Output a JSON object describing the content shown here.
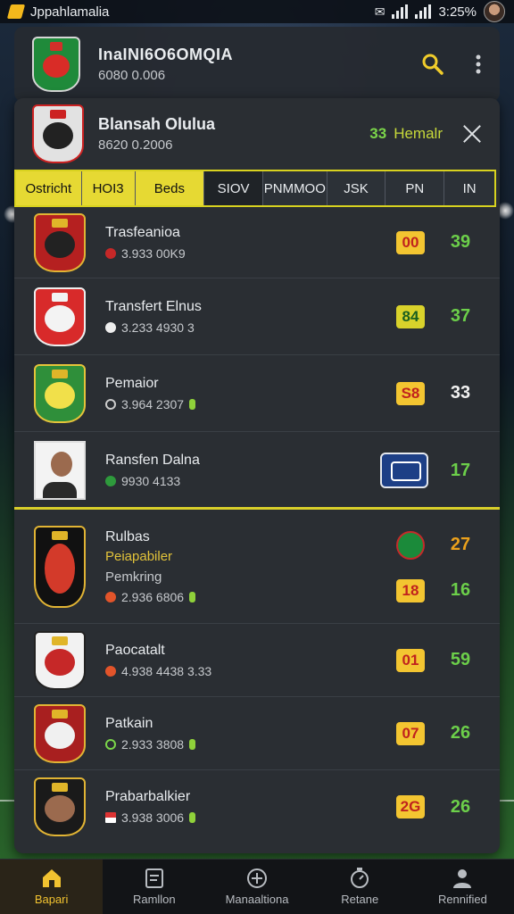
{
  "status_bar": {
    "app_name": "Jppahlamalia",
    "time": "3:25%"
  },
  "header": {
    "title": "InaINI6O6OMQIA",
    "subtitle": "6080 0.006"
  },
  "panel": {
    "title": "Blansah Olulua",
    "subtitle": "8620 0.2006",
    "status_num": "33",
    "status_label": "Hemalr"
  },
  "tabs": [
    {
      "label": "Ostricht",
      "style": "yellow"
    },
    {
      "label": "HOI3",
      "style": "yellow"
    },
    {
      "label": "Beds",
      "style": "yellow"
    },
    {
      "label": "SIOV",
      "style": "active"
    },
    {
      "label": "PNMMOO",
      "style": "dark"
    },
    {
      "label": "JSK",
      "style": "dark"
    },
    {
      "label": "PN",
      "style": "dark"
    },
    {
      "label": "IN",
      "style": "dark"
    }
  ],
  "rows": [
    {
      "name": "Trasfeanioa",
      "meta": "3.933 00K9",
      "pill": "00",
      "score": "39"
    },
    {
      "name": "Transfert Elnus",
      "meta": "3.233 4930 3",
      "pill": "84",
      "score": "37"
    },
    {
      "name": "Pemaior",
      "meta": "3.964 2307",
      "pill": "S8",
      "score": "33"
    },
    {
      "name": "Ransfen Dalna",
      "meta": "9930 4133",
      "score": "17"
    },
    {
      "name": "Rulbas",
      "sub": "Peiapabiler",
      "sub2": "Pemkring",
      "meta": "2.936 6806",
      "pill": "18",
      "score": "16",
      "side_score": "27"
    },
    {
      "name": "Paocatalt",
      "meta": "4.938 4438 3.33",
      "pill": "01",
      "score": "59"
    },
    {
      "name": "Patkain",
      "meta": "2.933 3808",
      "pill": "07",
      "score": "26"
    },
    {
      "name": "Prabarbalkier",
      "meta": "3.938 3006",
      "pill": "2G",
      "score": "26"
    }
  ],
  "nav": [
    {
      "label": "Bapari",
      "icon": "home-icon"
    },
    {
      "label": "Ramllon",
      "icon": "clipboard-icon"
    },
    {
      "label": "Manaaltiona",
      "icon": "plus-circle-icon"
    },
    {
      "label": "Retane",
      "icon": "stopwatch-icon"
    },
    {
      "label": "Rennified",
      "icon": "profile-icon"
    }
  ],
  "colors": {
    "accent": "#e6d933",
    "score_green": "#6ccf4a",
    "pill_yellow": "#f3c531"
  }
}
